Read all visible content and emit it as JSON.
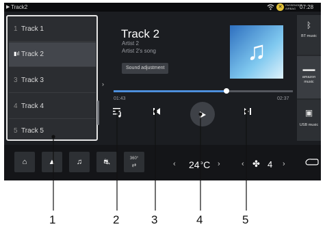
{
  "status_bar": {
    "title": "Track2",
    "airbag_text": "PASSENGER AIRBAG",
    "time": "07:28"
  },
  "tracklist": {
    "items": [
      {
        "number": "1",
        "name": "Track 1",
        "active": false
      },
      {
        "number": "",
        "name": "Track 2",
        "active": true
      },
      {
        "number": "3",
        "name": "Track 3",
        "active": false
      },
      {
        "number": "4",
        "name": "Track 4",
        "active": false
      },
      {
        "number": "5",
        "name": "Track 5",
        "active": false
      }
    ]
  },
  "now_playing": {
    "title": "Track 2",
    "artist": "Artist 2",
    "song": "Artist 2's song",
    "sound_button": "Sound adjustment",
    "elapsed": "01:43",
    "total": "02:37",
    "progress": 0.63
  },
  "sources": {
    "bt": "BT music",
    "amazon": "amazon music",
    "usb": "USB music"
  },
  "bottom_bar": {
    "recirc_label": "360°",
    "temperature": "24°C",
    "fan_level": "4"
  },
  "callouts": [
    "1",
    "2",
    "3",
    "4",
    "5"
  ],
  "colors": {
    "accent": "#4d8fdd",
    "screen_bg": "#1b1d21",
    "callout_line": "#111111"
  }
}
